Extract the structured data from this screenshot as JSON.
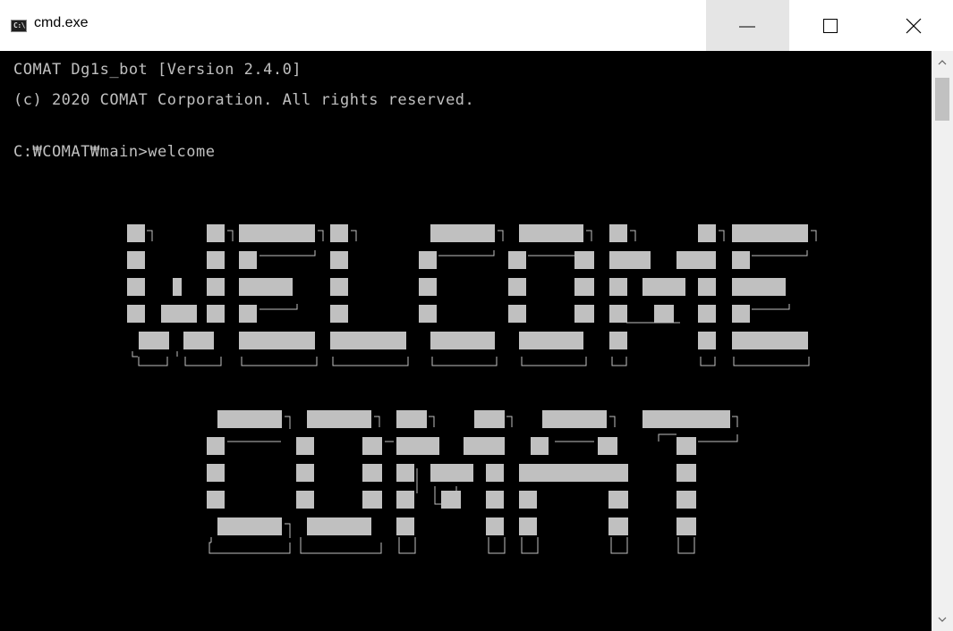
{
  "window": {
    "title": "cmd.exe",
    "icon_text": "C:\\",
    "controls": [
      "minimize-icon",
      "maximize-icon",
      "close-icon"
    ]
  },
  "console": {
    "lines": [
      "COMAT Dg1s_bot [Version 2.4.0]",
      "(c) 2020 COMAT Corporation. All rights reserved.",
      "",
      "C:₩COMAT₩main>welcome"
    ],
    "banner_text": [
      "WELCOME",
      "COMAT"
    ],
    "colors": {
      "background": "#000000",
      "text": "#c0c0c0",
      "block": "#c0c0c0"
    }
  }
}
